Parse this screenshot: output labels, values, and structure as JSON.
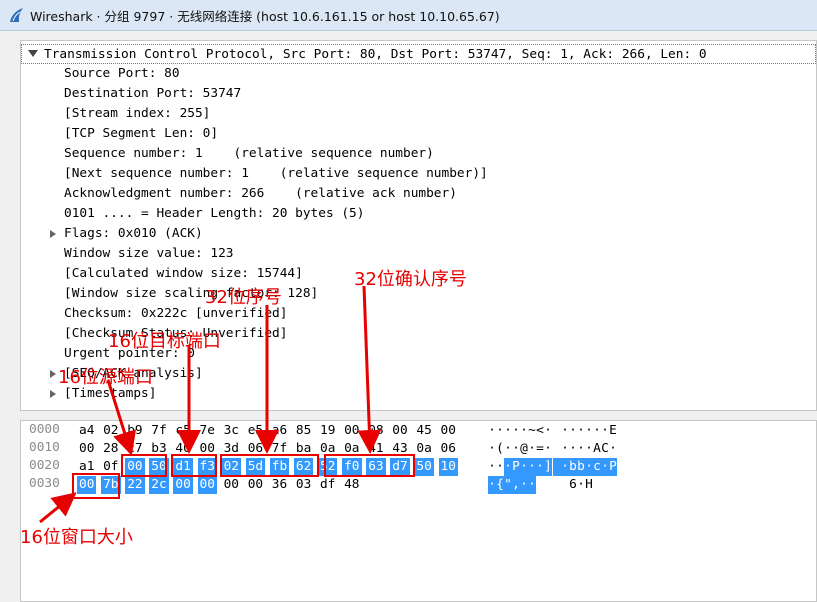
{
  "window": {
    "title": "Wireshark · 分组 9797 · 无线网络连接 (host 10.6.161.15 or host 10.10.65.67)"
  },
  "details": {
    "header": "Transmission Control Protocol, Src Port: 80, Dst Port: 53747, Seq: 1, Ack: 266, Len: 0",
    "fields": [
      "Source Port: 80",
      "Destination Port: 53747",
      "[Stream index: 255]",
      "[TCP Segment Len: 0]",
      "Sequence number: 1    (relative sequence number)",
      "[Next sequence number: 1    (relative sequence number)]",
      "Acknowledgment number: 266    (relative ack number)",
      "0101 .... = Header Length: 20 bytes (5)",
      "Flags: 0x010 (ACK)",
      "Window size value: 123",
      "[Calculated window size: 15744]",
      "[Window size scaling factor: 128]",
      "Checksum: 0x222c [unverified]",
      "[Checksum Status: Unverified]",
      "Urgent pointer: 0",
      "[SEQ/ACK analysis]",
      "[Timestamps]"
    ]
  },
  "bytes": {
    "offsets": [
      "0000",
      "0010",
      "0020",
      "0030"
    ],
    "hex": [
      [
        "a4",
        "02",
        "b9",
        "7f",
        "c5",
        "7e",
        "3c",
        "e5",
        "a6",
        "85",
        "19",
        "00",
        "08",
        "00",
        "45",
        "00"
      ],
      [
        "00",
        "28",
        "c7",
        "b3",
        "40",
        "00",
        "3d",
        "06",
        "7f",
        "ba",
        "0a",
        "0a",
        "41",
        "43",
        "0a",
        "06"
      ],
      [
        "a1",
        "0f",
        "00",
        "50",
        "d1",
        "f3",
        "02",
        "5d",
        "fb",
        "62",
        "52",
        "f0",
        "63",
        "d7",
        "50",
        "10"
      ],
      [
        "00",
        "7b",
        "22",
        "2c",
        "00",
        "00",
        "00",
        "00",
        "36",
        "03",
        "df",
        "48"
      ]
    ],
    "ascii": [
      [
        "·",
        "·",
        "·",
        "·",
        "·",
        "~",
        "<",
        "·",
        " ",
        "·",
        "·",
        "·",
        "·",
        "·",
        "·",
        "E"
      ],
      [
        "·",
        "(",
        "·",
        "·",
        "@",
        "·",
        "=",
        "·",
        " ",
        "·",
        "·",
        "·",
        "·",
        "A",
        "C",
        "·"
      ],
      [
        "·",
        "·",
        "·",
        "P",
        "·",
        "·",
        "·",
        "]",
        " ",
        "·",
        "b",
        "b",
        "·",
        "c",
        "·",
        "P"
      ],
      [
        "·",
        "{",
        "\"",
        ",",
        "·",
        "·",
        " ",
        " ",
        " ",
        " ",
        "6",
        "·",
        "H"
      ]
    ]
  },
  "annotations": {
    "window": "16位窗口大小",
    "src_port": "16位源端口",
    "dst_port": "16位目标端口",
    "seq": "32位序号",
    "ack": "32位确认序号"
  },
  "colors": {
    "highlight": "#3399ff",
    "annotation": "#e60000"
  }
}
